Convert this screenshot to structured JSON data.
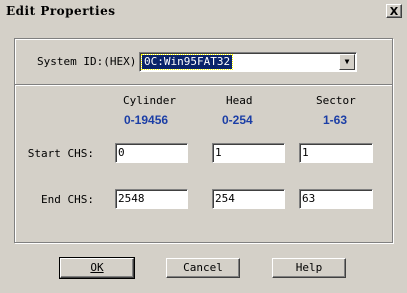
{
  "window": {
    "title": "Edit Properties",
    "close_glyph": "X"
  },
  "system_id": {
    "label": "System ID:(HEX)",
    "value": "0C:Win95FAT32",
    "arrow": "▼"
  },
  "columns": [
    {
      "header": "Cylinder",
      "range": "0-19456"
    },
    {
      "header": "Head",
      "range": "0-254"
    },
    {
      "header": "Sector",
      "range": "1-63"
    }
  ],
  "rows": {
    "start": {
      "label": "Start CHS:",
      "values": [
        "0",
        "1",
        "1"
      ]
    },
    "end": {
      "label": "End CHS:",
      "values": [
        "2548",
        "254",
        "63"
      ]
    }
  },
  "buttons": {
    "ok": "OK",
    "cancel": "Cancel",
    "help": "Help"
  },
  "colors": {
    "range_text": "#1b3ea6",
    "selection": "#0a246a",
    "face": "#d4d0c8"
  }
}
